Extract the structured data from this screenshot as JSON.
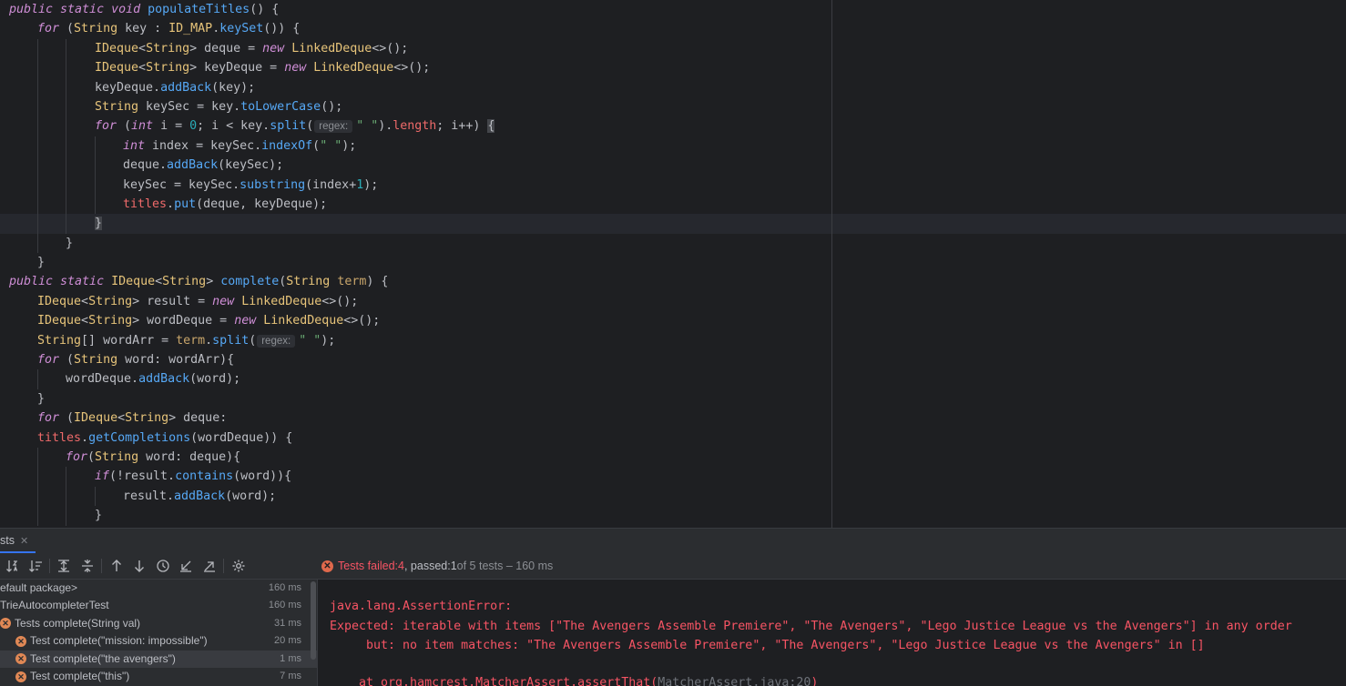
{
  "editor": {
    "lines": [
      {
        "indent": 0,
        "tokens": [
          [
            "kw",
            "public static void "
          ],
          [
            "fn",
            "populateTitles"
          ],
          [
            "",
            "() {"
          ]
        ]
      },
      {
        "indent": 1,
        "tokens": [
          [
            "kw",
            "for "
          ],
          [
            "",
            "("
          ],
          [
            "ty",
            "String"
          ],
          [
            "",
            " key : "
          ],
          [
            "ty",
            "ID_MAP"
          ],
          [
            "",
            "."
          ],
          [
            "fn",
            "keySet"
          ],
          [
            "",
            "()) {"
          ]
        ]
      },
      {
        "indent": 3,
        "tokens": [
          [
            "ty",
            "IDeque"
          ],
          [
            "",
            "<"
          ],
          [
            "ty",
            "String"
          ],
          [
            "",
            "> deque = "
          ],
          [
            "kw",
            "new "
          ],
          [
            "ty",
            "LinkedDeque"
          ],
          [
            "",
            "<>();"
          ]
        ]
      },
      {
        "indent": 3,
        "tokens": [
          [
            "ty",
            "IDeque"
          ],
          [
            "",
            "<"
          ],
          [
            "ty",
            "String"
          ],
          [
            "",
            "> keyDeque = "
          ],
          [
            "kw",
            "new "
          ],
          [
            "ty",
            "LinkedDeque"
          ],
          [
            "",
            "<>();"
          ]
        ]
      },
      {
        "indent": 3,
        "tokens": [
          [
            "",
            "keyDeque."
          ],
          [
            "fn",
            "addBack"
          ],
          [
            "",
            "(key);"
          ]
        ]
      },
      {
        "indent": 3,
        "tokens": [
          [
            "ty",
            "String"
          ],
          [
            "",
            " keySec = key."
          ],
          [
            "fn",
            "toLowerCase"
          ],
          [
            "",
            "();"
          ]
        ]
      },
      {
        "indent": 3,
        "tokens": [
          [
            "kw",
            "for "
          ],
          [
            "",
            "("
          ],
          [
            "kw",
            "int "
          ],
          [
            "",
            "i = "
          ],
          [
            "nm",
            "0"
          ],
          [
            "",
            "; i < key."
          ],
          [
            "fn",
            "split"
          ],
          [
            "",
            "("
          ],
          [
            "hint",
            "regex:"
          ],
          [
            "st",
            "\" \""
          ],
          [
            "",
            ")."
          ],
          [
            "fr",
            "length"
          ],
          [
            "",
            "; i++) "
          ],
          [
            "brace",
            "{"
          ]
        ]
      },
      {
        "indent": 4,
        "tokens": [
          [
            "kw",
            "int "
          ],
          [
            "",
            "index = keySec."
          ],
          [
            "fn",
            "indexOf"
          ],
          [
            "",
            "("
          ],
          [
            "st",
            "\" \""
          ],
          [
            "",
            ");"
          ]
        ]
      },
      {
        "indent": 4,
        "tokens": [
          [
            "",
            "deque."
          ],
          [
            "fn",
            "addBack"
          ],
          [
            "",
            "(keySec);"
          ]
        ]
      },
      {
        "indent": 4,
        "tokens": [
          [
            "",
            "keySec = keySec."
          ],
          [
            "fn",
            "substring"
          ],
          [
            "",
            "(index+"
          ],
          [
            "nm",
            "1"
          ],
          [
            "",
            ");"
          ]
        ]
      },
      {
        "indent": 4,
        "tokens": [
          [
            "fr",
            "titles"
          ],
          [
            "",
            "."
          ],
          [
            "fn",
            "put"
          ],
          [
            "",
            "(deque, keyDeque);"
          ]
        ]
      },
      {
        "indent": 3,
        "current": true,
        "tokens": [
          [
            "brace",
            "}"
          ]
        ]
      },
      {
        "indent": 2,
        "tokens": [
          [
            "",
            "}"
          ]
        ]
      },
      {
        "indent": 1,
        "tokens": [
          [
            "",
            "}"
          ]
        ]
      },
      {
        "indent": 0,
        "tokens": [
          [
            "kw",
            "public static "
          ],
          [
            "ty",
            "IDeque"
          ],
          [
            "",
            "<"
          ],
          [
            "ty",
            "String"
          ],
          [
            "",
            "> "
          ],
          [
            "fn",
            "complete"
          ],
          [
            "",
            "("
          ],
          [
            "ty",
            "String"
          ],
          [
            " ",
            " "
          ],
          [
            "pm",
            "term"
          ],
          [
            "",
            ") {"
          ]
        ]
      },
      {
        "indent": 1,
        "tokens": [
          [
            "ty",
            "IDeque"
          ],
          [
            "",
            "<"
          ],
          [
            "ty",
            "String"
          ],
          [
            "",
            "> result = "
          ],
          [
            "kw",
            "new "
          ],
          [
            "ty",
            "LinkedDeque"
          ],
          [
            "",
            "<>();"
          ]
        ]
      },
      {
        "indent": 1,
        "tokens": [
          [
            "ty",
            "IDeque"
          ],
          [
            "",
            "<"
          ],
          [
            "ty",
            "String"
          ],
          [
            "",
            "> wordDeque = "
          ],
          [
            "kw",
            "new "
          ],
          [
            "ty",
            "LinkedDeque"
          ],
          [
            "",
            "<>();"
          ]
        ]
      },
      {
        "indent": 1,
        "tokens": [
          [
            "ty",
            "String"
          ],
          [
            "",
            "[] wordArr = "
          ],
          [
            "pm",
            "term"
          ],
          [
            "",
            "."
          ],
          [
            "fn",
            "split"
          ],
          [
            "",
            "("
          ],
          [
            "hint",
            "regex:"
          ],
          [
            "st",
            "\" \""
          ],
          [
            "",
            ");"
          ]
        ]
      },
      {
        "indent": 1,
        "tokens": [
          [
            "kw",
            "for "
          ],
          [
            "",
            "("
          ],
          [
            "ty",
            "String"
          ],
          [
            "",
            " word: wordArr){"
          ]
        ]
      },
      {
        "indent": 2,
        "tokens": [
          [
            "",
            "wordDeque."
          ],
          [
            "fn",
            "addBack"
          ],
          [
            "",
            "(word);"
          ]
        ]
      },
      {
        "indent": 1,
        "tokens": [
          [
            "",
            "}"
          ]
        ]
      },
      {
        "indent": 1,
        "tokens": [
          [
            "kw",
            "for "
          ],
          [
            "",
            "("
          ],
          [
            "ty",
            "IDeque"
          ],
          [
            "",
            "<"
          ],
          [
            "ty",
            "String"
          ],
          [
            "",
            "> deque:"
          ]
        ]
      },
      {
        "indent": 1,
        "tokens": [
          [
            "fr",
            "titles"
          ],
          [
            "",
            "."
          ],
          [
            "fn",
            "getCompletions"
          ],
          [
            "",
            "(wordDeque)) {"
          ]
        ]
      },
      {
        "indent": 2,
        "tokens": [
          [
            "kw",
            "for"
          ],
          [
            "",
            "("
          ],
          [
            "ty",
            "String"
          ],
          [
            "",
            " word: deque){"
          ]
        ]
      },
      {
        "indent": 3,
        "tokens": [
          [
            "kw",
            "if"
          ],
          [
            "",
            "(!result."
          ],
          [
            "fn",
            "contains"
          ],
          [
            "",
            "(word)){"
          ]
        ]
      },
      {
        "indent": 4,
        "tokens": [
          [
            "",
            "result."
          ],
          [
            "fn",
            "addBack"
          ],
          [
            "",
            "(word);"
          ]
        ]
      },
      {
        "indent": 3,
        "tokens": [
          [
            "",
            "}"
          ]
        ]
      }
    ]
  },
  "tool_window": {
    "tab_label": "sts",
    "tab_close": "✕",
    "status": {
      "failed_label": "Tests failed: ",
      "failed_count": "4",
      "passed_label": ", passed: ",
      "passed_count": "1",
      "rest": " of 5 tests – 160 ms"
    },
    "toolbar_icons": [
      "sort-alpha-icon",
      "sort-duration-icon",
      "expand-all-icon",
      "collapse-all-icon",
      "previous-failed-icon",
      "next-failed-icon",
      "history-icon",
      "import-tests-icon",
      "export-tests-icon",
      "settings-icon"
    ],
    "tree": [
      {
        "label": "efault package>",
        "time": "160 ms",
        "indent": 0,
        "icon": false,
        "selected": false
      },
      {
        "label": "TrieAutocompleterTest",
        "time": "160 ms",
        "indent": 0,
        "icon": false,
        "selected": false
      },
      {
        "label": "Tests complete(String val)",
        "time": "31 ms",
        "indent": 0,
        "icon": true,
        "selected": false
      },
      {
        "label": "Test complete(\"mission: impossible\")",
        "time": "20 ms",
        "indent": 1,
        "icon": true,
        "selected": false
      },
      {
        "label": "Test complete(\"the avengers\")",
        "time": "1 ms",
        "indent": 1,
        "icon": true,
        "selected": true
      },
      {
        "label": "Test complete(\"this\")",
        "time": "7 ms",
        "indent": 1,
        "icon": true,
        "selected": false
      }
    ],
    "console": {
      "line1": "java.lang.AssertionError:",
      "line2": "Expected: iterable with items [\"The Avengers Assemble Premiere\", \"The Avengers\", \"Lego Justice League vs the Avengers\"] in any order",
      "line3": "     but: no item matches: \"The Avengers Assemble Premiere\", \"The Avengers\", \"Lego Justice League vs the Avengers\" in []",
      "line4a": "    at org.hamcrest.MatcherAssert.assertThat(",
      "line4b": "MatcherAssert.java:20",
      "line4c": ")"
    }
  }
}
